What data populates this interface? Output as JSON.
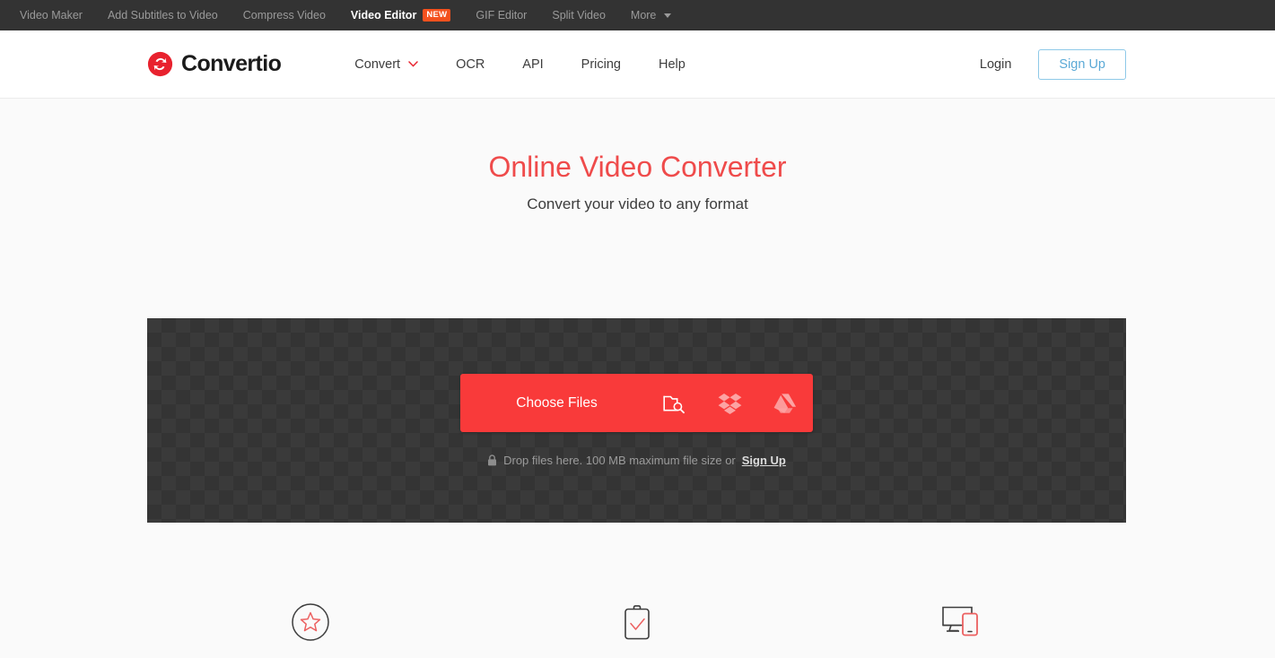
{
  "topbar": {
    "items": [
      {
        "label": "Video Maker",
        "active": false,
        "badge": null,
        "caret": false
      },
      {
        "label": "Add Subtitles to Video",
        "active": false,
        "badge": null,
        "caret": false
      },
      {
        "label": "Compress Video",
        "active": false,
        "badge": null,
        "caret": false
      },
      {
        "label": "Video Editor",
        "active": true,
        "badge": "NEW",
        "caret": false
      },
      {
        "label": "GIF Editor",
        "active": false,
        "badge": null,
        "caret": false
      },
      {
        "label": "Split Video",
        "active": false,
        "badge": null,
        "caret": false
      },
      {
        "label": "More",
        "active": false,
        "badge": null,
        "caret": true
      }
    ]
  },
  "header": {
    "logo_text": "Convertio",
    "logo_icon": "convert-arrows-icon",
    "nav": [
      {
        "label": "Convert",
        "caret": true
      },
      {
        "label": "OCR",
        "caret": false
      },
      {
        "label": "API",
        "caret": false
      },
      {
        "label": "Pricing",
        "caret": false
      },
      {
        "label": "Help",
        "caret": false
      }
    ],
    "login_label": "Login",
    "signup_label": "Sign Up"
  },
  "hero": {
    "title": "Online Video Converter",
    "subtitle": "Convert your video to any format"
  },
  "dropzone": {
    "choose_files_label": "Choose Files",
    "sources": [
      {
        "icon": "folder-search-icon",
        "name": "local-files"
      },
      {
        "icon": "dropbox-icon",
        "name": "dropbox"
      },
      {
        "icon": "google-drive-icon",
        "name": "google-drive"
      }
    ],
    "note_lock_icon": "lock-icon",
    "note_text": "Drop files here. 100 MB maximum file size or",
    "note_link": "Sign Up"
  },
  "features": [
    {
      "icon": "star-in-circle-icon",
      "name": "feature-quality"
    },
    {
      "icon": "clipboard-check-icon",
      "name": "feature-settings"
    },
    {
      "icon": "desktop-mobile-icon",
      "name": "feature-devices"
    }
  ],
  "colors": {
    "brand_red": "#F93A3A",
    "title_red": "#EF4B4B",
    "badge_orange": "#F4511E",
    "topbar_bg": "#333333",
    "page_bg": "#FAFAFA",
    "dropzone_bg": "#3A3A3A",
    "signup_blue": "#5AA9D6"
  }
}
